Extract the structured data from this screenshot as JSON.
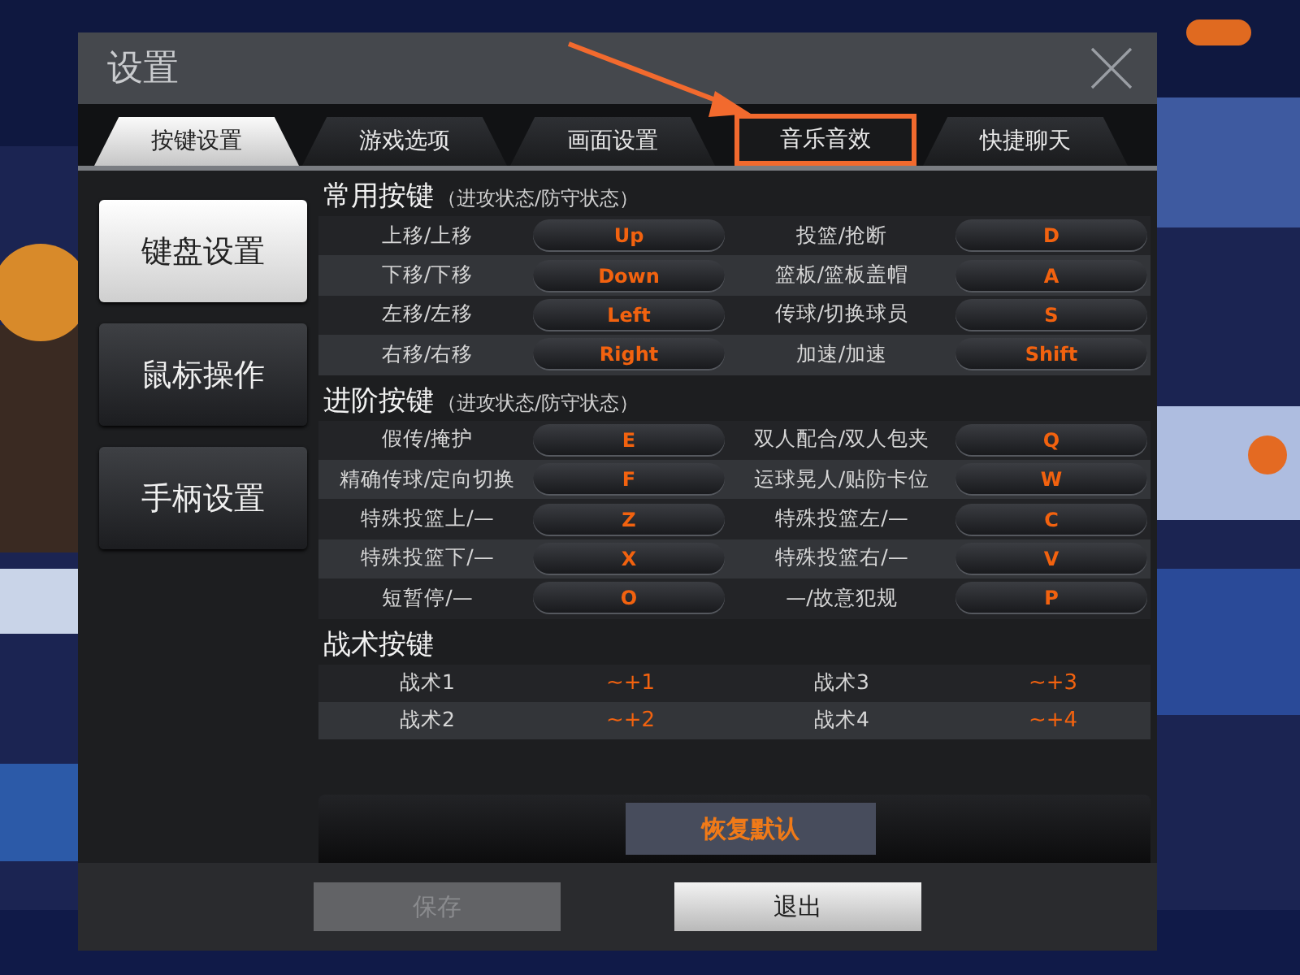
{
  "window": {
    "title": "设置"
  },
  "tabs": [
    {
      "label": "按键设置",
      "selected": true,
      "highlighted": false
    },
    {
      "label": "游戏选项",
      "selected": false,
      "highlighted": false
    },
    {
      "label": "画面设置",
      "selected": false,
      "highlighted": false
    },
    {
      "label": "音乐音效",
      "selected": false,
      "highlighted": true
    },
    {
      "label": "快捷聊天",
      "selected": false,
      "highlighted": false
    }
  ],
  "sidebar": {
    "items": [
      {
        "label": "键盘设置",
        "selected": true
      },
      {
        "label": "鼠标操作",
        "selected": false
      },
      {
        "label": "手柄设置",
        "selected": false
      }
    ]
  },
  "sections": [
    {
      "title": "常用按键",
      "note": "（进攻状态/防守状态）",
      "kind": "keys",
      "rows": [
        {
          "left_action": "上移/上移",
          "left_key": "Up",
          "right_action": "投篮/抢断",
          "right_key": "D"
        },
        {
          "left_action": "下移/下移",
          "left_key": "Down",
          "right_action": "篮板/篮板盖帽",
          "right_key": "A"
        },
        {
          "left_action": "左移/左移",
          "left_key": "Left",
          "right_action": "传球/切换球员",
          "right_key": "S"
        },
        {
          "left_action": "右移/右移",
          "left_key": "Right",
          "right_action": "加速/加速",
          "right_key": "Shift"
        }
      ]
    },
    {
      "title": "进阶按键",
      "note": "（进攻状态/防守状态）",
      "kind": "keys",
      "rows": [
        {
          "left_action": "假传/掩护",
          "left_key": "E",
          "right_action": "双人配合/双人包夹",
          "right_key": "Q"
        },
        {
          "left_action": "精确传球/定向切换",
          "left_key": "F",
          "right_action": "运球晃人/贴防卡位",
          "right_key": "W"
        },
        {
          "left_action": "特殊投篮上/—",
          "left_key": "Z",
          "right_action": "特殊投篮左/—",
          "right_key": "C"
        },
        {
          "left_action": "特殊投篮下/—",
          "left_key": "X",
          "right_action": "特殊投篮右/—",
          "right_key": "V"
        },
        {
          "left_action": "短暂停/—",
          "left_key": "O",
          "right_action": "—/故意犯规",
          "right_key": "P"
        }
      ]
    },
    {
      "title": "战术按键",
      "kind": "plain",
      "rows": [
        {
          "left_action": "战术1",
          "left_key": "~+1",
          "right_action": "战术3",
          "right_key": "~+3"
        },
        {
          "left_action": "战术2",
          "left_key": "~+2",
          "right_action": "战术4",
          "right_key": "~+4"
        }
      ]
    }
  ],
  "restore_button": "恢复默认",
  "buttons": [
    {
      "label": "保存",
      "disabled": true
    },
    {
      "label": "退出",
      "disabled": false
    }
  ]
}
